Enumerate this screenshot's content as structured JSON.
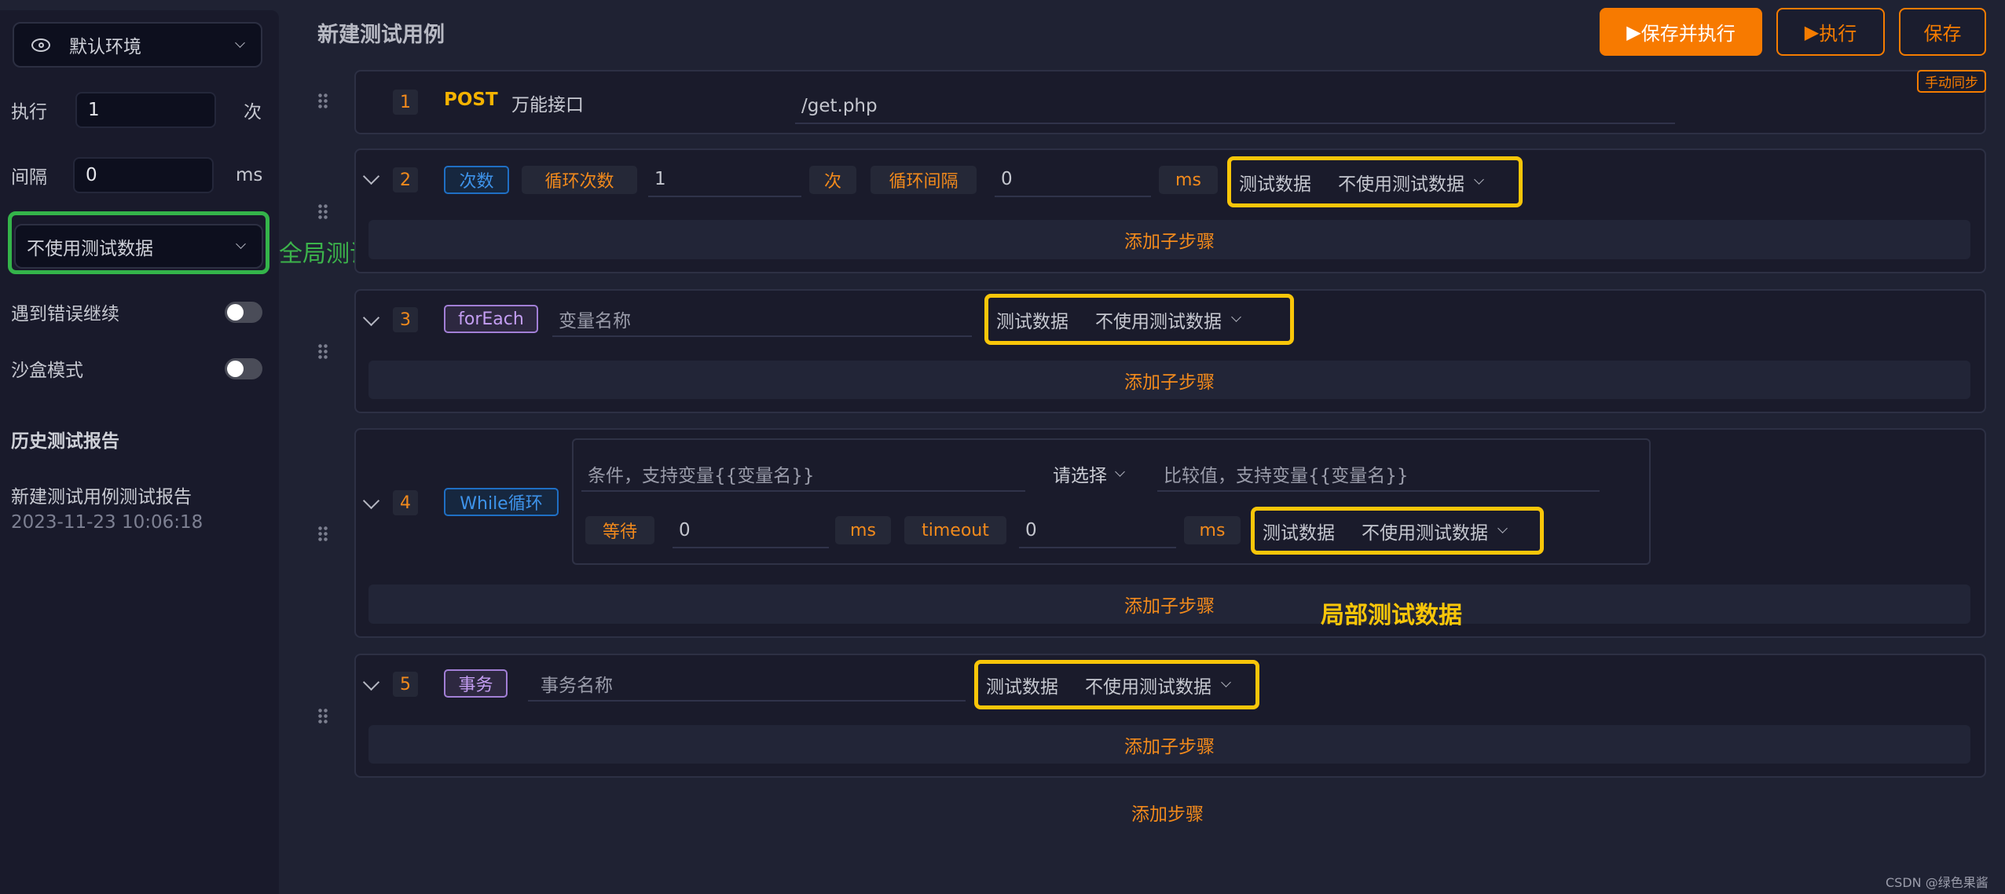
{
  "sidebar": {
    "env": "默认环境",
    "exec_label": "执行",
    "exec_value": "1",
    "exec_unit": "次",
    "interval_label": "间隔",
    "interval_value": "0",
    "interval_unit": "ms",
    "test_data": "不使用测试数据",
    "continue_on_error": "遇到错误继续",
    "continue_on_error_on": false,
    "sandbox": "沙盒模式",
    "sandbox_on": false,
    "history_title": "历史测试报告",
    "reports": [
      {
        "name": "新建测试用例测试报告",
        "time": "2023-11-23 10:06:18"
      }
    ]
  },
  "annotations": {
    "global": "全局测试数据",
    "local": "局部测试数据",
    "global_color": "#3cb44b",
    "local_color": "#f9c609"
  },
  "header": {
    "title": "新建测试用例",
    "save_run": "保存并执行",
    "run": "执行",
    "save": "保存",
    "sync": "手动同步"
  },
  "steps": [
    {
      "index": "1",
      "method": "POST",
      "name": "万能接口",
      "path": "/get.php"
    },
    {
      "index": "2",
      "type": "次数",
      "count_label": "循环次数",
      "count": "1",
      "count_unit": "次",
      "interval_label": "循环间隔",
      "interval": "0",
      "interval_unit": "ms",
      "data_label": "测试数据",
      "data_value": "不使用测试数据",
      "add_child": "添加子步骤"
    },
    {
      "index": "3",
      "type": "forEach",
      "var_placeholder": "变量名称",
      "data_label": "测试数据",
      "data_value": "不使用测试数据",
      "add_child": "添加子步骤"
    },
    {
      "index": "4",
      "type": "While循环",
      "cond_placeholder": "条件，支持变量{{变量名}}",
      "operator": "请选择",
      "compare_placeholder": "比较值，支持变量{{变量名}}",
      "wait_label": "等待",
      "wait": "0",
      "wait_unit": "ms",
      "timeout_label": "timeout",
      "timeout": "0",
      "timeout_unit": "ms",
      "data_label": "测试数据",
      "data_value": "不使用测试数据",
      "add_child": "添加子步骤"
    },
    {
      "index": "5",
      "type": "事务",
      "name_placeholder": "事务名称",
      "data_label": "测试数据",
      "data_value": "不使用测试数据",
      "add_child": "添加子步骤"
    }
  ],
  "add_step": "添加步骤",
  "watermark": "CSDN @绿色果酱"
}
